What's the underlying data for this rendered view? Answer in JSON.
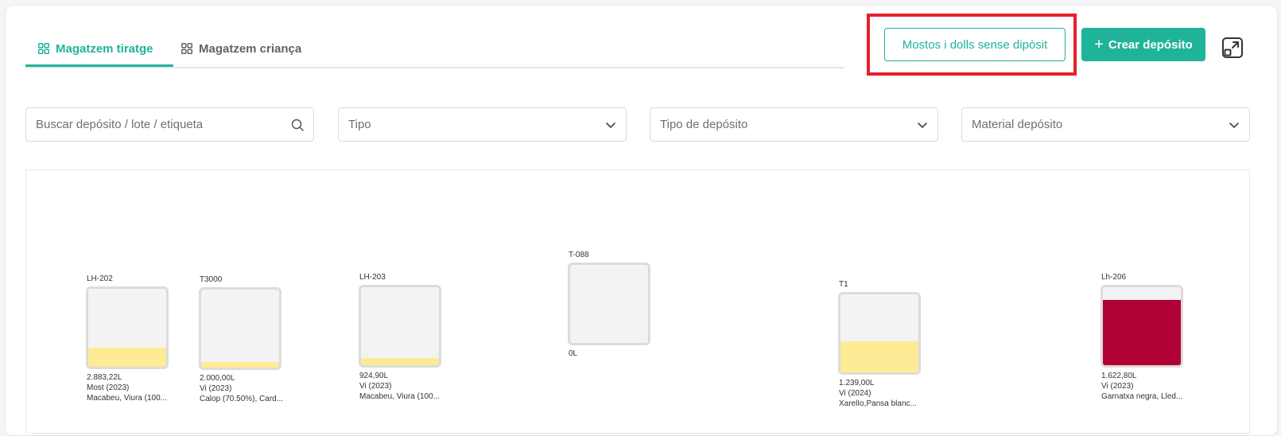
{
  "tabs": [
    {
      "label": "Magatzem tiratge",
      "active": true
    },
    {
      "label": "Magatzem criança",
      "active": false
    }
  ],
  "header": {
    "outline_button": "Mostos i dolls sense dipòsit",
    "primary_button": "Crear depósito",
    "expand_icon": "external-link-icon"
  },
  "filters": {
    "search_placeholder": "Buscar depósito / lote / etiqueta",
    "tipo": "Tipo",
    "tipo_deposito": "Tipo de depósito",
    "material_deposito": "Material depósito"
  },
  "colors": {
    "accent": "#1fb39a",
    "highlight": "#e3212b",
    "white_wine": "#fdeb95",
    "red_wine": "#b00034"
  },
  "tanks": [
    {
      "name": "LH-202",
      "fill": 0.25,
      "color": "#fdeb95",
      "volume": "2.883,22L",
      "type": "Most (2023)",
      "variety": "Macabeu, Viura (100..."
    },
    {
      "name": "T3000",
      "fill": 0.07,
      "color": "#fdeb95",
      "volume": "2.000,00L",
      "type": "Vi (2023)",
      "variety": "Calop (70.50%), Card..."
    },
    {
      "name": "LH-203",
      "fill": 0.09,
      "color": "#fdeb95",
      "volume": "924,90L",
      "type": "Vi (2023)",
      "variety": "Macabeu, Viura (100..."
    },
    {
      "name": "T-088",
      "fill": 0.0,
      "color": "#fdeb95",
      "volume": "0L",
      "type": "",
      "variety": ""
    },
    {
      "name": "T1",
      "fill": 0.4,
      "color": "#fdeb95",
      "volume": "1.239,00L",
      "type": "Vi (2024)",
      "variety": "XarelIo,Pansa blanc..."
    },
    {
      "name": "Lh-206",
      "fill": 0.84,
      "color": "#b00034",
      "volume": "1.622,80L",
      "type": "Vi (2023)",
      "variety": "Garnatxa negra, Lled..."
    }
  ]
}
